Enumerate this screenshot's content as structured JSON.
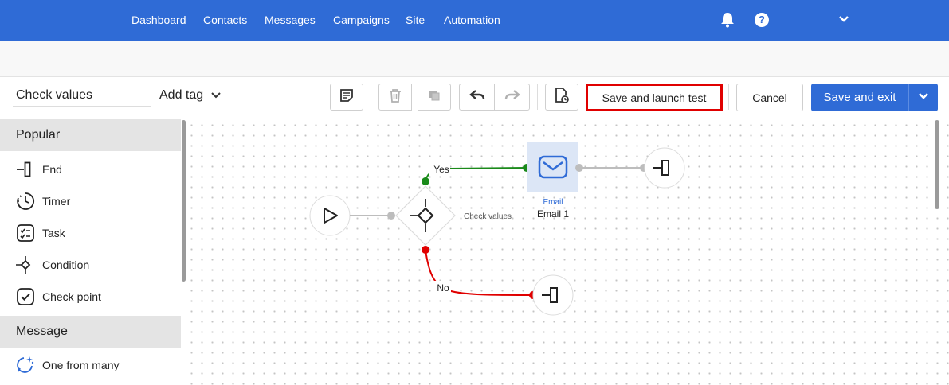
{
  "nav": {
    "items": [
      "Dashboard",
      "Contacts",
      "Messages",
      "Campaigns",
      "Site",
      "Automation"
    ],
    "help_glyph": "?"
  },
  "toolbar": {
    "name_value": "Check values",
    "add_tag": "Add tag",
    "save_launch_test": "Save and launch test",
    "cancel": "Cancel",
    "save_exit": "Save and exit"
  },
  "sidebar": {
    "sections": [
      {
        "title": "Popular",
        "items": [
          "End",
          "Timer",
          "Task",
          "Condition",
          "Check point"
        ]
      },
      {
        "title": "Message",
        "items": [
          "One from many"
        ]
      }
    ]
  },
  "canvas": {
    "condition_label": "Check values",
    "yes_label": "Yes",
    "no_label": "No",
    "email_type": "Email",
    "email_name": "Email 1"
  },
  "colors": {
    "brand": "#2f6bd6",
    "yes": "#1a8a1a",
    "no": "#e00000",
    "highlight": "#e00000"
  }
}
